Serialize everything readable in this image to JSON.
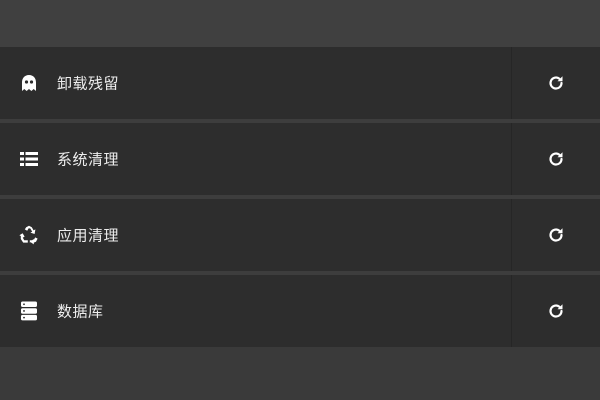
{
  "colors": {
    "background": "#3d3d3d",
    "row_background": "#2d2d2d",
    "text": "#ededed",
    "icon": "#ffffff"
  },
  "rows": [
    {
      "label": "卸载残留",
      "icon": "ghost-icon",
      "action_icon": "refresh-icon"
    },
    {
      "label": "系统清理",
      "icon": "list-icon",
      "action_icon": "refresh-icon"
    },
    {
      "label": "应用清理",
      "icon": "recycle-icon",
      "action_icon": "refresh-icon"
    },
    {
      "label": "数据库",
      "icon": "database-icon",
      "action_icon": "refresh-icon"
    }
  ]
}
